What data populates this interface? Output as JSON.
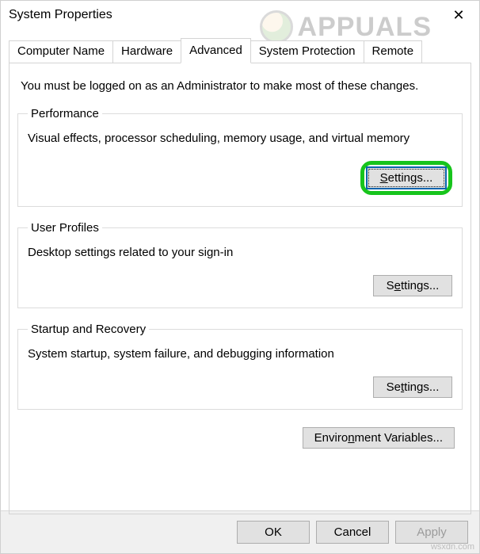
{
  "window": {
    "title": "System Properties"
  },
  "tabs": {
    "items": [
      {
        "label": "Computer Name"
      },
      {
        "label": "Hardware"
      },
      {
        "label": "Advanced",
        "active": true
      },
      {
        "label": "System Protection"
      },
      {
        "label": "Remote"
      }
    ]
  },
  "panel": {
    "intro": "You must be logged on as an Administrator to make most of these changes.",
    "performance": {
      "legend": "Performance",
      "desc": "Visual effects, processor scheduling, memory usage, and virtual memory",
      "button": "Settings..."
    },
    "userprofiles": {
      "legend": "User Profiles",
      "desc": "Desktop settings related to your sign-in",
      "button": "Settings..."
    },
    "startup": {
      "legend": "Startup and Recovery",
      "desc": "System startup, system failure, and debugging information",
      "button": "Settings..."
    },
    "env_button": "Environment Variables..."
  },
  "footer": {
    "ok": "OK",
    "cancel": "Cancel",
    "apply": "Apply"
  },
  "watermark": {
    "text": "APPUALS"
  },
  "attribution": "wsxdn.com"
}
